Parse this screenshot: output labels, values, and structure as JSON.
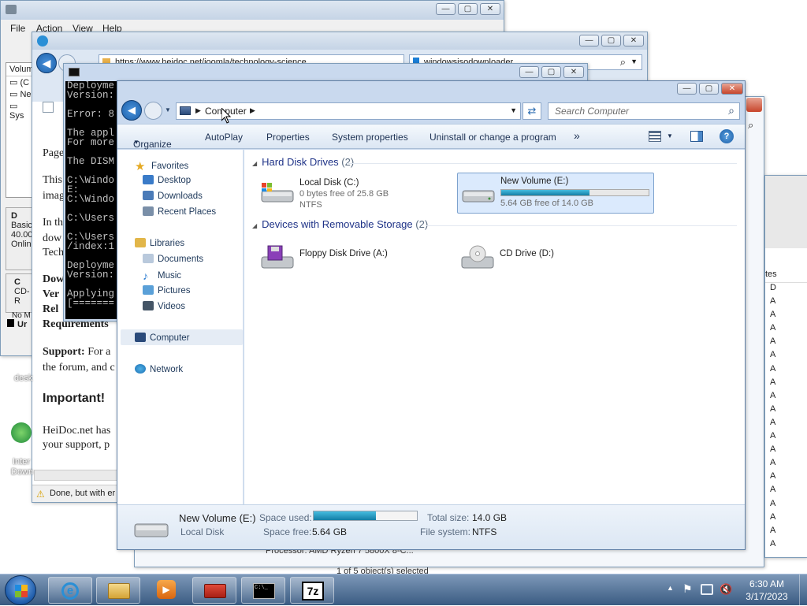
{
  "back_window": {
    "menu": [
      "File",
      "Action",
      "View",
      "Help"
    ],
    "col_header": "Volum",
    "items": [
      "(C",
      "Ne",
      "Sys"
    ],
    "disk": {
      "name": "D",
      "lines": [
        "Basic",
        "40.00",
        "Onlin"
      ]
    },
    "cdrom": {
      "name": "C",
      "line": "CD-R"
    },
    "no_media": "No M",
    "legend": "Ur"
  },
  "browser": {
    "url": "https://www.heidoc.net/joomla/technology-science",
    "search": "windowsisodownloader",
    "paragraphs": [
      "Page",
      "This",
      "imag",
      "In th",
      "dow",
      "Tech"
    ],
    "dow": "Dow",
    "ver": "Ver",
    "rel": "Rel",
    "requirements": "Requirements",
    "support_bold": "Support:",
    "support_text": " For a",
    "forum": "the forum, and c",
    "important": "Important!",
    "heidoc": "HeiDoc.net has",
    "your_support": "your support, p",
    "status": "Done, but with er"
  },
  "console": {
    "lines": [
      "Deployme",
      "Version:",
      "",
      "Error: 8",
      "",
      "The appl",
      "For more",
      "",
      "The DISM",
      "",
      "C:\\Windo",
      "E:",
      "C:\\Windo",
      "",
      "C:\\Users",
      "",
      "C:\\Users",
      "/index:1",
      "",
      "Deployme",
      "Version:",
      "",
      "Applying",
      "[======="
    ]
  },
  "desktop": {
    "label1": "desk",
    "label2": "Inter",
    "label3": "Down"
  },
  "right_window": {
    "col": "tes",
    "rows": [
      "D",
      "A",
      "A",
      "A",
      "A",
      "A",
      "A",
      "A",
      "A",
      "A",
      "A",
      "A",
      "A",
      "A",
      "A",
      "A",
      "A",
      "A",
      "A",
      "A"
    ]
  },
  "behind_text": {
    "processor": "Processor:  AMD Ryzen 7 5800X 8-C...",
    "selected": "1 of 5 object(s) selected"
  },
  "explorer": {
    "breadcrumb": "Computer",
    "search_placeholder": "Search Computer",
    "toolbar": [
      "Organize",
      "AutoPlay",
      "Properties",
      "System properties",
      "Uninstall or change a program"
    ],
    "more": "»",
    "nav": {
      "favorites": "Favorites",
      "desktop": "Desktop",
      "downloads": "Downloads",
      "recent": "Recent Places",
      "libraries": "Libraries",
      "documents": "Documents",
      "music": "Music",
      "pictures": "Pictures",
      "videos": "Videos",
      "computer": "Computer",
      "network": "Network"
    },
    "groups": {
      "hdd": "Hard Disk Drives",
      "hdd_count": "(2)",
      "removable": "Devices with Removable Storage",
      "removable_count": "(2)"
    },
    "drives": {
      "c": {
        "name": "Local Disk (C:)",
        "free": "0 bytes free of 25.8 GB",
        "fs": "NTFS"
      },
      "e": {
        "name": "New Volume (E:)",
        "free": "5.64 GB free of 14.0 GB",
        "used_fraction": 0.6
      },
      "a": {
        "name": "Floppy Disk Drive (A:)"
      },
      "d": {
        "name": "CD Drive (D:)"
      }
    },
    "details": {
      "name": "New Volume (E:)",
      "type": "Local Disk",
      "used_label": "Space used:",
      "free_label": "Space free:",
      "free_value": "5.64 GB",
      "total_label": "Total size:",
      "total_value": "14.0 GB",
      "fs_label": "File system:",
      "fs_value": "NTFS",
      "used_fraction": 0.6
    }
  },
  "taskbar": {
    "time": "6:30 AM",
    "date": "3/17/2023",
    "buttons": [
      "start",
      "internet-explorer",
      "windows-explorer",
      "media-player",
      "toolbox",
      "command-prompt",
      "7-zip"
    ],
    "sevenzip": "7z",
    "cmd": "C:\\_"
  },
  "colors": {
    "accent": "#1f7db5",
    "selection": "#dbeafd"
  }
}
